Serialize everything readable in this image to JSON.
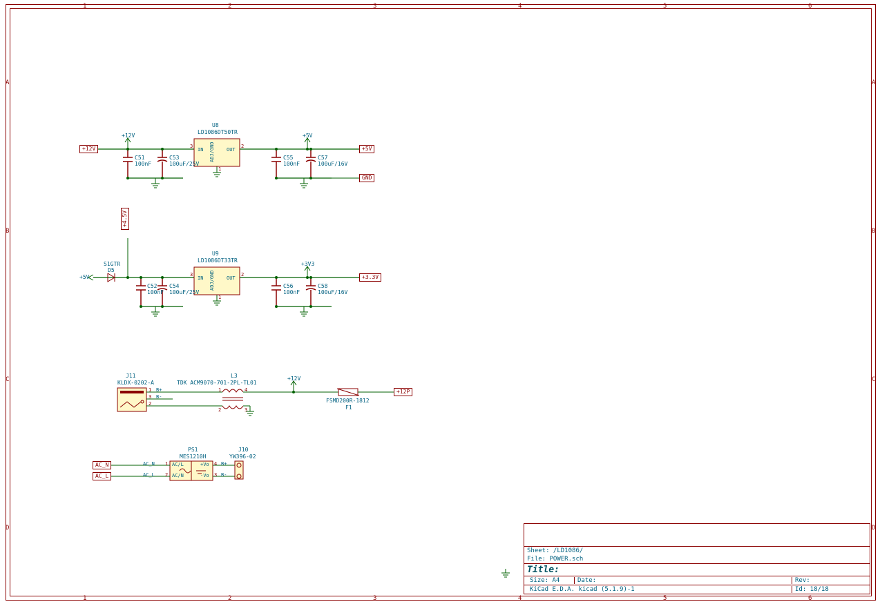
{
  "title_block": {
    "sheet": "Sheet: /LD1086/",
    "file": "File: POWER.sch",
    "title_label": "Title:",
    "size": "Size: A4",
    "date": "Date:",
    "rev": "Rev:",
    "kicad": "KiCad E.D.A.  kicad (5.1.9)-1",
    "id": "Id: 18/18"
  },
  "ruler_top": [
    "1",
    "2",
    "3",
    "4",
    "5",
    "6"
  ],
  "ruler_side": [
    "A",
    "B",
    "C",
    "D"
  ],
  "nets": {
    "p12v_in": "+12V",
    "p5v_out": "+5V",
    "gnd": "GND",
    "p5v_in": "+5V",
    "p3v3": "+3.3V",
    "p12p": "+12P",
    "ac_n": "AC_N",
    "ac_l": "AC_L",
    "pwr_12v": "+12V",
    "pwr_5v": "+5V",
    "pwr_3v3": "+3V3",
    "pwr_4_5v": "+4.5V"
  },
  "u8": {
    "ref": "U8",
    "val": "LD1086DT50TR",
    "pin_in": "IN",
    "pin_out": "OUT",
    "pin_adj": "ADJ/GND",
    "n1": "1",
    "n2": "2",
    "n3": "3"
  },
  "u9": {
    "ref": "U9",
    "val": "LD1086DT33TR",
    "pin_in": "IN",
    "pin_out": "OUT",
    "pin_adj": "ADJ/GND",
    "n1": "1",
    "n2": "2",
    "n3": "3"
  },
  "caps": {
    "c51": {
      "ref": "C51",
      "val": "100nF"
    },
    "c53": {
      "ref": "C53",
      "val": "100uF/25V"
    },
    "c55": {
      "ref": "C55",
      "val": "100nF"
    },
    "c57": {
      "ref": "C57",
      "val": "100uF/16V"
    },
    "c52": {
      "ref": "C52",
      "val": "100nF"
    },
    "c54": {
      "ref": "C54",
      "val": "100uF/25V"
    },
    "c56": {
      "ref": "C56",
      "val": "100nF"
    },
    "c58": {
      "ref": "C58",
      "val": "100uF/16V"
    }
  },
  "d5": {
    "ref": "D5",
    "val": "S1GTR"
  },
  "j11": {
    "ref": "J11",
    "val": "KLDX-0202-A",
    "p1": "1",
    "p2": "2",
    "p3": "3",
    "bplus": "B+",
    "bminus": "B-"
  },
  "l3": {
    "ref": "L3",
    "val": "TDK ACM9070-701-2PL-TL01",
    "p1": "1",
    "p2": "2",
    "p3": "3",
    "p4": "4"
  },
  "f1": {
    "ref": "F1",
    "val": "FSMD200R-1812"
  },
  "ps1": {
    "ref": "PS1",
    "val": "MES1210H",
    "acl": "AC/L",
    "acn": "AC/N",
    "vp": "+Vo",
    "vn": "-Vo",
    "acn_lbl": "AC_N",
    "acl_lbl": "AC_L",
    "p1": "1",
    "p2": "2",
    "p3": "3",
    "p4": "4",
    "bp": "B+",
    "bn": "B-"
  },
  "j10": {
    "ref": "J10",
    "val": "YW396-02"
  }
}
